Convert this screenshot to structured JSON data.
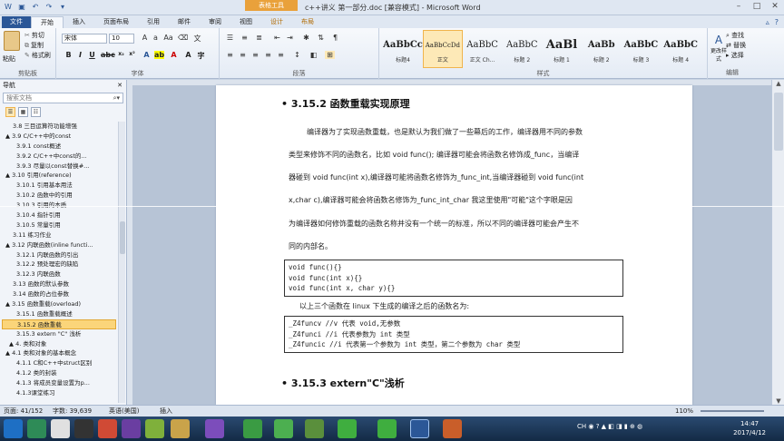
{
  "window": {
    "title": "c++讲义 第一部分.doc [兼容模式] - Microsoft Word",
    "context_tab": "表格工具"
  },
  "tabs": [
    "文件",
    "开始",
    "插入",
    "页面布局",
    "引用",
    "邮件",
    "审阅",
    "视图",
    "设计",
    "布局"
  ],
  "ribbon": {
    "clipboard": {
      "label": "剪贴板",
      "paste": "粘贴",
      "cut": "剪切",
      "copy": "复制",
      "format_painter": "格式刷"
    },
    "font": {
      "label": "字体",
      "name": "宋体",
      "size": "10"
    },
    "paragraph": {
      "label": "段落"
    },
    "styles": {
      "label": "样式",
      "items": [
        {
          "sample": "AaBbCc",
          "name": "标题4"
        },
        {
          "sample": "AaBbCcDd",
          "name": "正文"
        },
        {
          "sample": "AaBbC",
          "name": "正文 Ch..."
        },
        {
          "sample": "AaBbC",
          "name": "标题 2"
        },
        {
          "sample": "AaBl",
          "name": "标题 1"
        },
        {
          "sample": "AaBb",
          "name": "标题 2"
        },
        {
          "sample": "AaBbC",
          "name": "标题 3"
        },
        {
          "sample": "AaBbC",
          "name": "标题 4"
        }
      ],
      "change": "更改样式"
    },
    "editing": {
      "label": "编辑",
      "find": "查找",
      "replace": "替换",
      "select": "选择"
    }
  },
  "nav": {
    "title": "导航",
    "search_placeholder": "搜索文档",
    "tree": [
      "3.8 三目运算符功能增强",
      "▲ 3.9 C/C++中的const",
      "3.9.1 const概述",
      "3.9.2 C/C++中const的...",
      "3.9.3 尽量以const替换#...",
      "▲ 3.10 引用(reference)",
      "3.10.1 引用基本用法",
      "3.10.2 函数中的引用",
      "3.10.3 引用的本质",
      "3.10.4 指针引用",
      "3.10.5 常量引用",
      "3.11 练习作业",
      "▲ 3.12 内联函数(inline functi...",
      "3.12.1 内联函数的引出",
      "3.12.2 预处理宏的缺陷",
      "3.12.3 内联函数",
      "3.13 函数的默认参数",
      "3.14 函数的占位参数",
      "▲ 3.15 函数重载(overload)",
      "3.15.1 函数重载概述",
      "3.15.2 函数重载",
      "3.15.3 extern \"C\" 浅析",
      "▲ 4. 类和对象",
      "▲ 4.1 类和对象的基本概念",
      "4.1.1 C和C++中struct区别",
      "4.1.2 类的封装",
      "4.1.3 将成员变量设置为p...",
      "4.1.3课堂练习"
    ],
    "selected_index": 20
  },
  "document": {
    "heading1": "3.15.2 函数重载实现原理",
    "paragraph1": [
      "编译器为了实现函数重载，也是默认为我们做了一些幕后的工作，编译器用不同的参数",
      "类型来修饰不同的函数名，比如 void func(); 编译器可能会将函数名修饰成_func，当编译",
      "器碰到 void func(int x),编译器可能将函数名修饰为_func_int,当编译器碰到 void func(int",
      "x,char c),编译器可能会将函数名修饰为_func_int_char 我这里使用\"可能\"这个字眼是因",
      "为编译器如何修饰重载的函数名称并没有一个统一的标准，所以不同的编译器可能会产生不",
      "同的内部名。"
    ],
    "code1": [
      "void func(){}",
      "void func(int x){}",
      "void func(int x, char y){}"
    ],
    "paragraph2": "以上三个函数在 linux 下生成的编译之后的函数名为:",
    "code2": [
      "_Z4funcv //v 代表 void,无参数",
      "_Z4funci //i 代表参数为 int 类型",
      "_Z4funcic //i 代表第一个参数为 int 类型，第二个参数为 char 类型"
    ],
    "heading2": "3.15.3 extern\"C\"浅析"
  },
  "status": {
    "page": "页面: 41/152",
    "words": "字数: 39,639",
    "lang": "英语(美国)",
    "mode": "插入",
    "zoom": "110%"
  },
  "clock": {
    "time": "14:47",
    "date": "2017/4/12"
  }
}
